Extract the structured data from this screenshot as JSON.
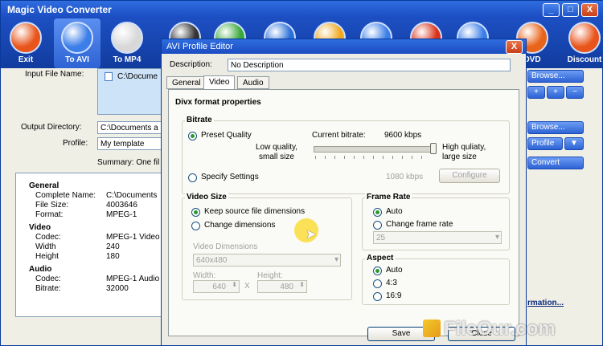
{
  "app": {
    "title": "Magic Video Converter",
    "min": "_",
    "max": "□",
    "close": "X"
  },
  "toolbar": [
    {
      "label": "Exit",
      "icon": "power-icon",
      "color": "#e8541a"
    },
    {
      "label": "To AVI",
      "icon": "play-icon",
      "color": "#3b7ee8"
    },
    {
      "label": "To MP4",
      "icon": "ipod-icon",
      "color": "#d8d8d8"
    },
    {
      "label": "",
      "icon": "phone-icon",
      "color": "#333333"
    },
    {
      "label": "",
      "icon": "video-icon",
      "color": "#3aa83a"
    },
    {
      "label": "",
      "icon": "quicktime-icon",
      "color": "#2b6fd8"
    },
    {
      "label": "",
      "icon": "media-player-icon",
      "color": "#f2a81e"
    },
    {
      "label": "",
      "icon": "wmv-icon",
      "color": "#3b7ee8"
    },
    {
      "label": "",
      "icon": "flash-icon",
      "color": "#d8321a"
    },
    {
      "label": "",
      "icon": "arrow-icon",
      "color": "#3b7ee8"
    },
    {
      "label": "DVD",
      "icon": "dvd-icon",
      "color": "#e8641a"
    },
    {
      "label": "Discount",
      "icon": "gift-box-icon",
      "color": "#e8541a"
    }
  ],
  "main": {
    "input_label": "Input File Name:",
    "input_value": "C:\\Docume",
    "output_label": "Output Directory:",
    "output_value": "C:\\Documents a",
    "profile_label": "Profile:",
    "profile_value": "My template",
    "summary_label": "Summary: One fil",
    "browse1": "Browse...",
    "browse2": "Browse...",
    "profile_btn": "Profile",
    "convert_btn": "Convert",
    "more_info": "rmation...",
    "info": {
      "general_head": "General",
      "complete_name_k": "Complete Name:",
      "complete_name_v": "C:\\Documents",
      "file_size_k": "File Size:",
      "file_size_v": "4003646",
      "format_k": "Format:",
      "format_v": "MPEG-1",
      "video_head": "Video",
      "vcodec_k": "Codec:",
      "vcodec_v": "MPEG-1 Video",
      "width_k": "Width",
      "width_v": "240",
      "height_k": "Height",
      "height_v": "180",
      "audio_head": "Audio",
      "acodec_k": "Codec:",
      "acodec_v": "MPEG-1 Audio",
      "bitrate_k": "Bitrate:",
      "bitrate_v": "32000"
    }
  },
  "dialog": {
    "title": "AVI Profile Editor",
    "close": "X",
    "desc_label": "Description:",
    "desc_value": "No Description",
    "tabs": [
      "General",
      "Video",
      "Audio"
    ],
    "section_title": "Divx format properties",
    "bitrate": {
      "title": "Bitrate",
      "preset": "Preset Quality",
      "current_label": "Current bitrate:",
      "current_value": "9600 kbps",
      "low": "Low quality,",
      "small": "small size",
      "high": "High quliaty,",
      "large": "large size",
      "specify": "Specify Settings",
      "kbps": "1080 kbps",
      "configure": "Configure",
      "slider_level": 0.98
    },
    "video_size": {
      "title": "Video Size",
      "keep": "Keep source file dimensions",
      "change": "Change dimensions",
      "dims_label": "Video Dimensions",
      "dims_value": "640x480",
      "width_label": "Width:",
      "width_value": "640",
      "x": "X",
      "height_label": "Height:",
      "height_value": "480"
    },
    "frame_rate": {
      "title": "Frame Rate",
      "auto": "Auto",
      "change": "Change frame rate",
      "value": "25"
    },
    "aspect": {
      "title": "Aspect",
      "auto": "Auto",
      "r43": "4:3",
      "r169": "16:9"
    },
    "save": "Save",
    "close_btn": "Close"
  },
  "watermark": "FileOur.com"
}
